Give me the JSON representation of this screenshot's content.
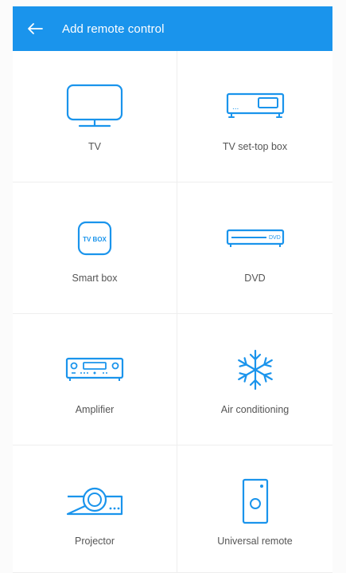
{
  "colors": {
    "accent": "#1a94ec",
    "icon": "#1a94ec",
    "label_text": "#555555",
    "background": "#fbfbfb"
  },
  "header": {
    "back_icon": "arrow-left-icon",
    "title": "Add remote control"
  },
  "devices": [
    {
      "label": "TV",
      "icon": "tv-icon"
    },
    {
      "label": "TV set-top box",
      "icon": "set-top-box-icon",
      "icon_text": "..."
    },
    {
      "label": "Smart box",
      "icon": "smart-box-icon",
      "icon_text": "TV BOX"
    },
    {
      "label": "DVD",
      "icon": "dvd-player-icon",
      "icon_text": "DVD"
    },
    {
      "label": "Amplifier",
      "icon": "amplifier-icon"
    },
    {
      "label": "Air conditioning",
      "icon": "snowflake-icon"
    },
    {
      "label": "Projector",
      "icon": "projector-icon"
    },
    {
      "label": "Universal remote",
      "icon": "remote-icon"
    }
  ]
}
